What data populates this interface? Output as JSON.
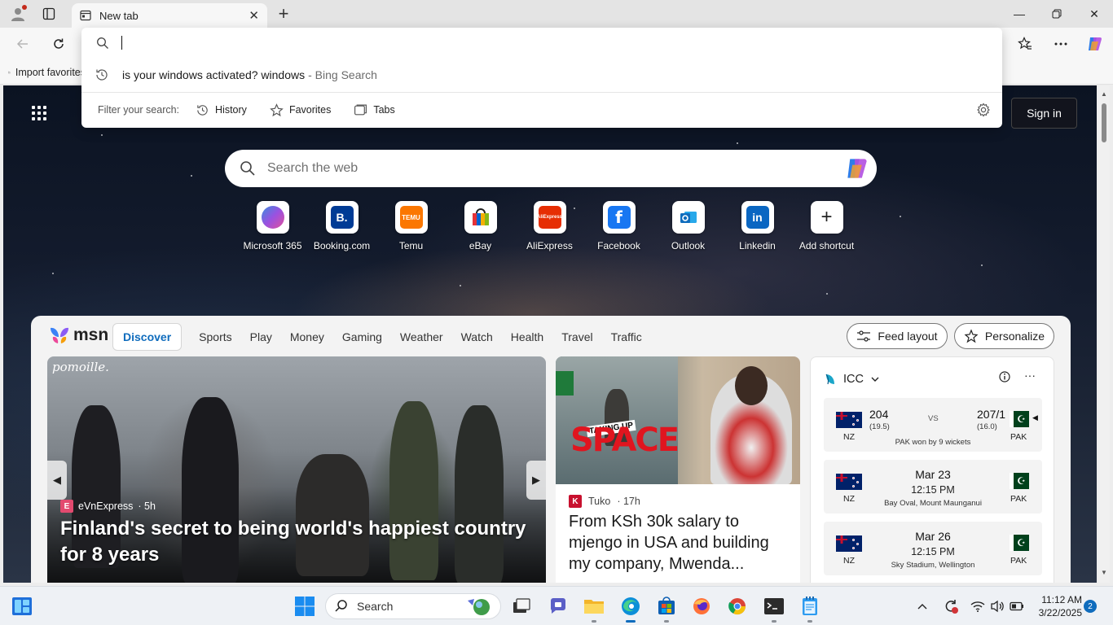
{
  "browser": {
    "tab_title": "New tab",
    "favorites_bar": {
      "import_label": "Import favorites"
    }
  },
  "omnibox": {
    "input_value": "",
    "suggestion": {
      "text": "is your windows activated? windows",
      "source": "- Bing Search"
    },
    "filter_label": "Filter your search:",
    "filters": [
      "History",
      "Favorites",
      "Tabs"
    ]
  },
  "newtab": {
    "signin_label": "Sign in",
    "search_placeholder": "Search the web",
    "shortcuts": [
      {
        "label": "Microsoft 365",
        "icon": "microsoft-365-icon",
        "color": "#7b5cd6"
      },
      {
        "label": "Booking.com",
        "icon": "booking-icon",
        "color": "#003b95"
      },
      {
        "label": "Temu",
        "icon": "temu-icon",
        "color": "#fb7701"
      },
      {
        "label": "eBay",
        "icon": "ebay-icon",
        "color": "#222222"
      },
      {
        "label": "AliExpress",
        "icon": "aliexpress-icon",
        "color": "#e62e04"
      },
      {
        "label": "Facebook",
        "icon": "facebook-icon",
        "color": "#1877f2"
      },
      {
        "label": "Outlook",
        "icon": "outlook-icon",
        "color": "#0f6cbd"
      },
      {
        "label": "Linkedin",
        "icon": "linkedin-icon",
        "color": "#0a66c2"
      },
      {
        "label": "Add shortcut",
        "icon": "plus-icon",
        "color": "#ffffff"
      }
    ]
  },
  "feed": {
    "brand": "msn",
    "nav": [
      "Discover",
      "Sports",
      "Play",
      "Money",
      "Gaming",
      "Weather",
      "Watch",
      "Health",
      "Travel",
      "Traffic"
    ],
    "feed_layout_label": "Feed layout",
    "personalize_label": "Personalize",
    "hero": {
      "watermark": "pomoille.",
      "source": "eVnExpress",
      "age": "· 5h",
      "title": "Finland's secret to being world's happiest country for 8 years"
    },
    "card2": {
      "image_text_small": "TAKING UP",
      "image_text_big": "SPACE",
      "source": "Tuko",
      "age": "· 17h",
      "title": "From KSh 30k salary to mjengo in USA and building my company, Mwenda..."
    },
    "cricket": {
      "title": "ICC",
      "matches": [
        {
          "team1": "NZ",
          "team2": "PAK",
          "score1": "204",
          "overs1": "(19.5)",
          "vs": "VS",
          "score2": "207/1",
          "overs2": "(16.0)",
          "result": "PAK won by 9 wickets"
        },
        {
          "team1": "NZ",
          "team2": "PAK",
          "date": "Mar 23",
          "time": "12:15 PM",
          "venue": "Bay Oval, Mount Maunganui"
        },
        {
          "team1": "NZ",
          "team2": "PAK",
          "date": "Mar 26",
          "time": "12:15 PM",
          "venue": "Sky Stadium, Wellington"
        }
      ]
    }
  },
  "taskbar": {
    "search_label": "Search",
    "time": "11:12 AM",
    "date": "3/22/2025",
    "notifications": "2"
  }
}
